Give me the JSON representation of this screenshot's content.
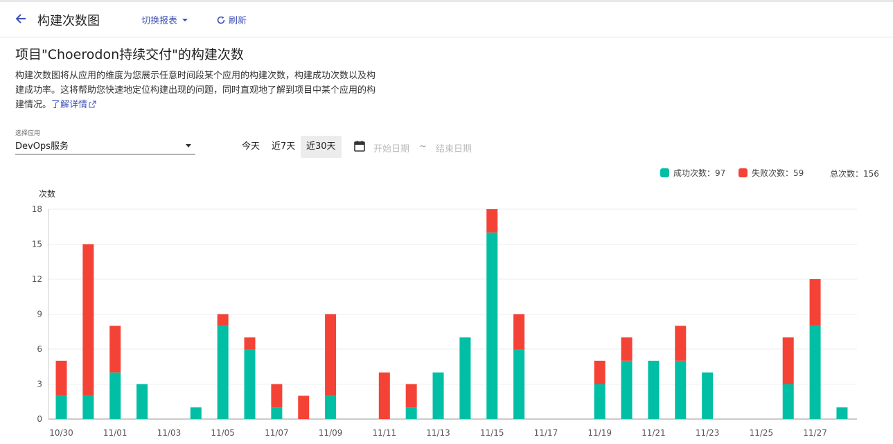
{
  "header": {
    "title": "构建次数图",
    "switch_report": "切换报表",
    "refresh": "刷新"
  },
  "heading": "项目\"Choerodon持续交付\"的构建次数",
  "description": {
    "text": "构建次数图将从应用的维度为您展示任意时间段某个应用的构建次数，构建成功次数以及构建成功率。这将帮助您快速地定位构建出现的问题，同时直观地了解到项目中某个应用的构建情况。",
    "link": "了解详情"
  },
  "app_select": {
    "label": "选择应用",
    "value": "DevOps服务"
  },
  "ranges": [
    "今天",
    "近7天",
    "近30天"
  ],
  "active_range": "近30天",
  "date_range": {
    "start_placeholder": "开始日期",
    "separator": "~",
    "end_placeholder": "结束日期"
  },
  "legend": {
    "success": "成功次数：97",
    "fail": "失败次数：59",
    "total": "总次数：156"
  },
  "colors": {
    "success": "#00bfa5",
    "fail": "#f44336",
    "accent": "#3f51b5"
  },
  "chart_data": {
    "type": "bar",
    "stacked": true,
    "ylabel": "次数",
    "ylim": [
      0,
      18
    ],
    "yticks": [
      0,
      3,
      6,
      9,
      12,
      15,
      18
    ],
    "categories": [
      "10/30",
      "10/31",
      "11/01",
      "11/02",
      "11/03",
      "11/04",
      "11/05",
      "11/06",
      "11/07",
      "11/08",
      "11/09",
      "11/10",
      "11/11",
      "11/12",
      "11/13",
      "11/14",
      "11/15",
      "11/16",
      "11/17",
      "11/18",
      "11/19",
      "11/20",
      "11/21",
      "11/22",
      "11/23",
      "11/24",
      "11/25",
      "11/26",
      "11/27",
      "11/28"
    ],
    "xtick_labels": [
      "10/30",
      "11/01",
      "11/03",
      "11/05",
      "11/07",
      "11/09",
      "11/11",
      "11/13",
      "11/15",
      "11/17",
      "11/19",
      "11/21",
      "11/23",
      "11/25",
      "11/27"
    ],
    "series": [
      {
        "name": "成功次数",
        "values": [
          2,
          2,
          4,
          3,
          0,
          1,
          8,
          6,
          1,
          0,
          2,
          0,
          0,
          1,
          4,
          7,
          16,
          6,
          0,
          0,
          3,
          5,
          5,
          5,
          4,
          0,
          0,
          3,
          8,
          1
        ]
      },
      {
        "name": "失败次数",
        "values": [
          3,
          13,
          4,
          0,
          0,
          0,
          1,
          1,
          2,
          2,
          7,
          0,
          4,
          2,
          0,
          0,
          2,
          3,
          0,
          0,
          2,
          2,
          0,
          3,
          0,
          0,
          0,
          4,
          4,
          0
        ]
      }
    ]
  }
}
